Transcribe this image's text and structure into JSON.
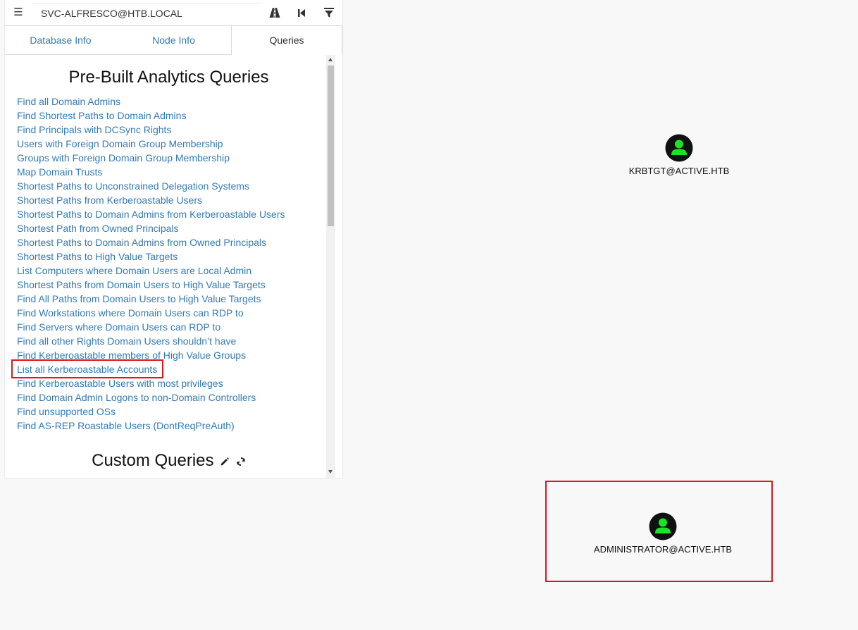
{
  "search": {
    "value": "SVC-ALFRESCO@HTB.LOCAL",
    "icons": [
      "menu-icon",
      "road-icon",
      "step-backward-icon",
      "filter-icon"
    ]
  },
  "tabs": [
    {
      "label": "Database Info",
      "active": false
    },
    {
      "label": "Node Info",
      "active": false
    },
    {
      "label": "Queries",
      "active": true
    }
  ],
  "queries": {
    "prebuilt_title": "Pre-Built Analytics Queries",
    "items": [
      "Find all Domain Admins",
      "Find Shortest Paths to Domain Admins",
      "Find Principals with DCSync Rights",
      "Users with Foreign Domain Group Membership",
      "Groups with Foreign Domain Group Membership",
      "Map Domain Trusts",
      "Shortest Paths to Unconstrained Delegation Systems",
      "Shortest Paths from Kerberoastable Users",
      "Shortest Paths to Domain Admins from Kerberoastable Users",
      "Shortest Path from Owned Principals",
      "Shortest Paths to Domain Admins from Owned Principals",
      "Shortest Paths to High Value Targets",
      "List Computers where Domain Users are Local Admin",
      "Shortest Paths from Domain Users to High Value Targets",
      "Find All Paths from Domain Users to High Value Targets",
      "Find Workstations where Domain Users can RDP to",
      "Find Servers where Domain Users can RDP to",
      "Find all other Rights Domain Users shouldn’t have",
      "Find Kerberoastable members of High Value Groups",
      "List all Kerberoastable Accounts",
      "Find Kerberoastable Users with most privileges",
      "Find Domain Admin Logons to non-Domain Controllers",
      "Find unsupported OSs",
      "Find AS-REP Roastable Users (DontReqPreAuth)"
    ],
    "highlighted": "List all Kerberoastable Accounts",
    "custom_title": "Custom Queries",
    "custom_icons": [
      "pencil-icon",
      "refresh-icon"
    ]
  },
  "graph": {
    "nodes": [
      {
        "label": "KRBTGT@ACTIVE.HTB",
        "type": "user-icon"
      },
      {
        "label": "ADMINISTRATOR@ACTIVE.HTB",
        "type": "user-icon"
      }
    ],
    "node_color": "#17e625",
    "node_bg": "#111111"
  },
  "colors": {
    "link": "#337ab7",
    "highlight": "#e0141b"
  }
}
